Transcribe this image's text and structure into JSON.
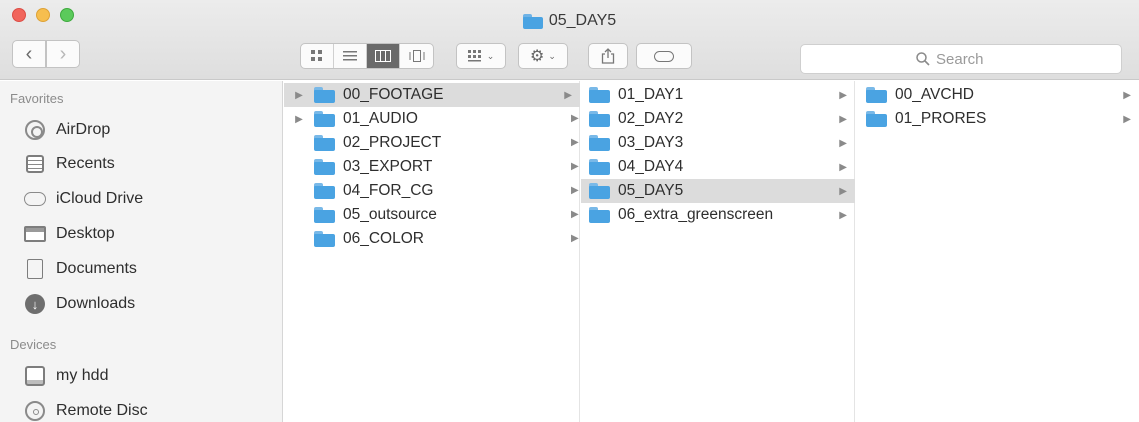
{
  "window": {
    "title": "05_DAY5",
    "title_icon": "folder-icon"
  },
  "toolbar": {
    "back_glyph": "‹",
    "forward_glyph": "›",
    "view_modes": [
      "icon",
      "list",
      "column",
      "coverflow"
    ],
    "active_view": "column",
    "search": {
      "placeholder": "Search"
    }
  },
  "sidebar": {
    "favorites_label": "Favorites",
    "favorites": [
      {
        "label": "AirDrop",
        "icon": "airdrop-icon"
      },
      {
        "label": "Recents",
        "icon": "recents-icon"
      },
      {
        "label": "iCloud Drive",
        "icon": "cloud-icon"
      },
      {
        "label": "Desktop",
        "icon": "desktop-icon"
      },
      {
        "label": "Documents",
        "icon": "documents-icon"
      },
      {
        "label": "Downloads",
        "icon": "downloads-icon"
      }
    ],
    "devices_label": "Devices",
    "devices": [
      {
        "label": "my hdd",
        "icon": "hdd-icon"
      },
      {
        "label": "Remote Disc",
        "icon": "disc-icon"
      }
    ]
  },
  "columns": {
    "col1": [
      {
        "name": "00_FOOTAGE",
        "selected": true,
        "expand": true
      },
      {
        "name": "01_AUDIO",
        "selected": false,
        "expand": true
      },
      {
        "name": "02_PROJECT",
        "selected": false,
        "expand": false
      },
      {
        "name": "03_EXPORT",
        "selected": false,
        "expand": false
      },
      {
        "name": "04_FOR_CG",
        "selected": false,
        "expand": false
      },
      {
        "name": "05_outsource",
        "selected": false,
        "expand": false
      },
      {
        "name": "06_COLOR",
        "selected": false,
        "expand": false
      }
    ],
    "col2": [
      {
        "name": "01_DAY1",
        "selected": false
      },
      {
        "name": "02_DAY2",
        "selected": false
      },
      {
        "name": "03_DAY3",
        "selected": false
      },
      {
        "name": "04_DAY4",
        "selected": false
      },
      {
        "name": "05_DAY5",
        "selected": true
      },
      {
        "name": "06_extra_greenscreen",
        "selected": false
      }
    ],
    "col3": [
      {
        "name": "00_AVCHD",
        "selected": false
      },
      {
        "name": "01_PRORES",
        "selected": false
      }
    ]
  }
}
